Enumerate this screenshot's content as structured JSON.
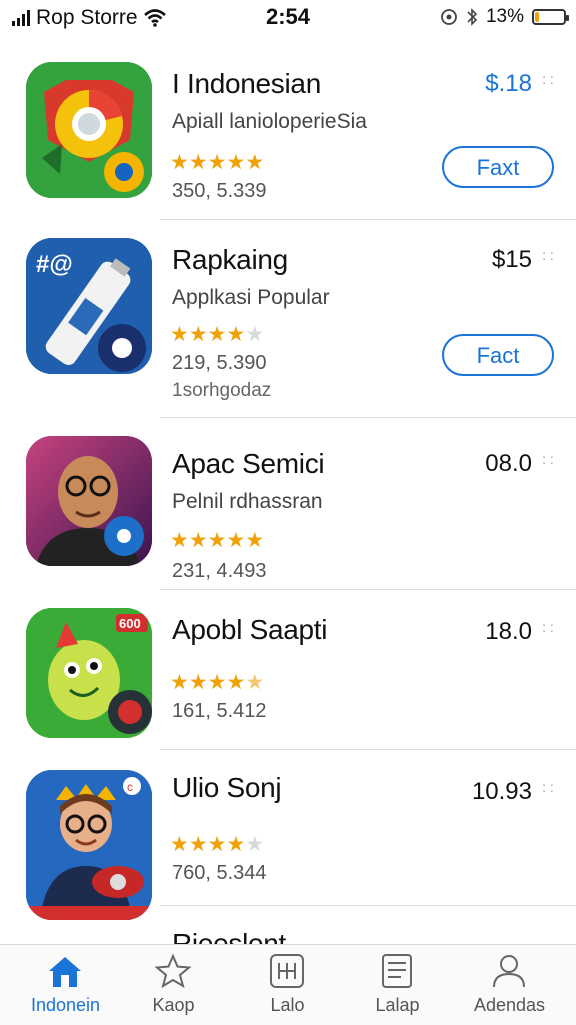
{
  "status": {
    "carrier": "Rop Storre",
    "time": "2:54",
    "battery": "13%",
    "battery_level": 0.13,
    "icons": [
      "signal-icon",
      "wifi-icon",
      "location-icon",
      "bluetooth-icon",
      "battery-icon"
    ]
  },
  "apps": [
    {
      "name": "I Indonesian",
      "subtitle": "Apiall lanioloperieSia",
      "rating": 5,
      "count": "350, 5.339",
      "extra": "",
      "price": "$.18",
      "button": "Faxt",
      "price_color": "#1a73d6"
    },
    {
      "name": "Rapkaing",
      "subtitle": "Applkasi Popular",
      "rating": 4,
      "count": "219, 5.390",
      "extra": "1sorhgodaz",
      "price": "$15",
      "button": "Fact",
      "price_color": "#111111"
    },
    {
      "name": "Apac Semici",
      "subtitle": "Pelnil rdhassran",
      "rating": 5,
      "count": "231, 4.493",
      "extra": "",
      "price": "08.0",
      "button": "",
      "price_color": "#111111"
    },
    {
      "name": "Apobl Saapti",
      "subtitle": "",
      "rating": 4.5,
      "count": "161, 5.412",
      "extra": "",
      "price": "18.0",
      "button": "",
      "price_color": "#111111"
    },
    {
      "name": "Ulio Sonj",
      "subtitle": "",
      "rating": 4,
      "count": "760, 5.344",
      "extra": "",
      "price": "10.93",
      "button": "",
      "price_color": "#111111"
    },
    {
      "name": "Rieeslent",
      "subtitle": "",
      "rating": 0,
      "count": "",
      "extra": "",
      "price": "",
      "button": "",
      "price_color": "#111111"
    }
  ],
  "tabs": [
    {
      "label": "Indonein",
      "icon": "home-icon",
      "active": true
    },
    {
      "label": "Kaop",
      "icon": "star-icon",
      "active": false
    },
    {
      "label": "Lalo",
      "icon": "grid-icon",
      "active": false
    },
    {
      "label": "Lalap",
      "icon": "document-icon",
      "active": false
    },
    {
      "label": "Adendas",
      "icon": "person-icon",
      "active": false
    }
  ],
  "colors": {
    "accent": "#1a73d6",
    "star": "#f0a20b",
    "battery": "#f0a30a"
  }
}
